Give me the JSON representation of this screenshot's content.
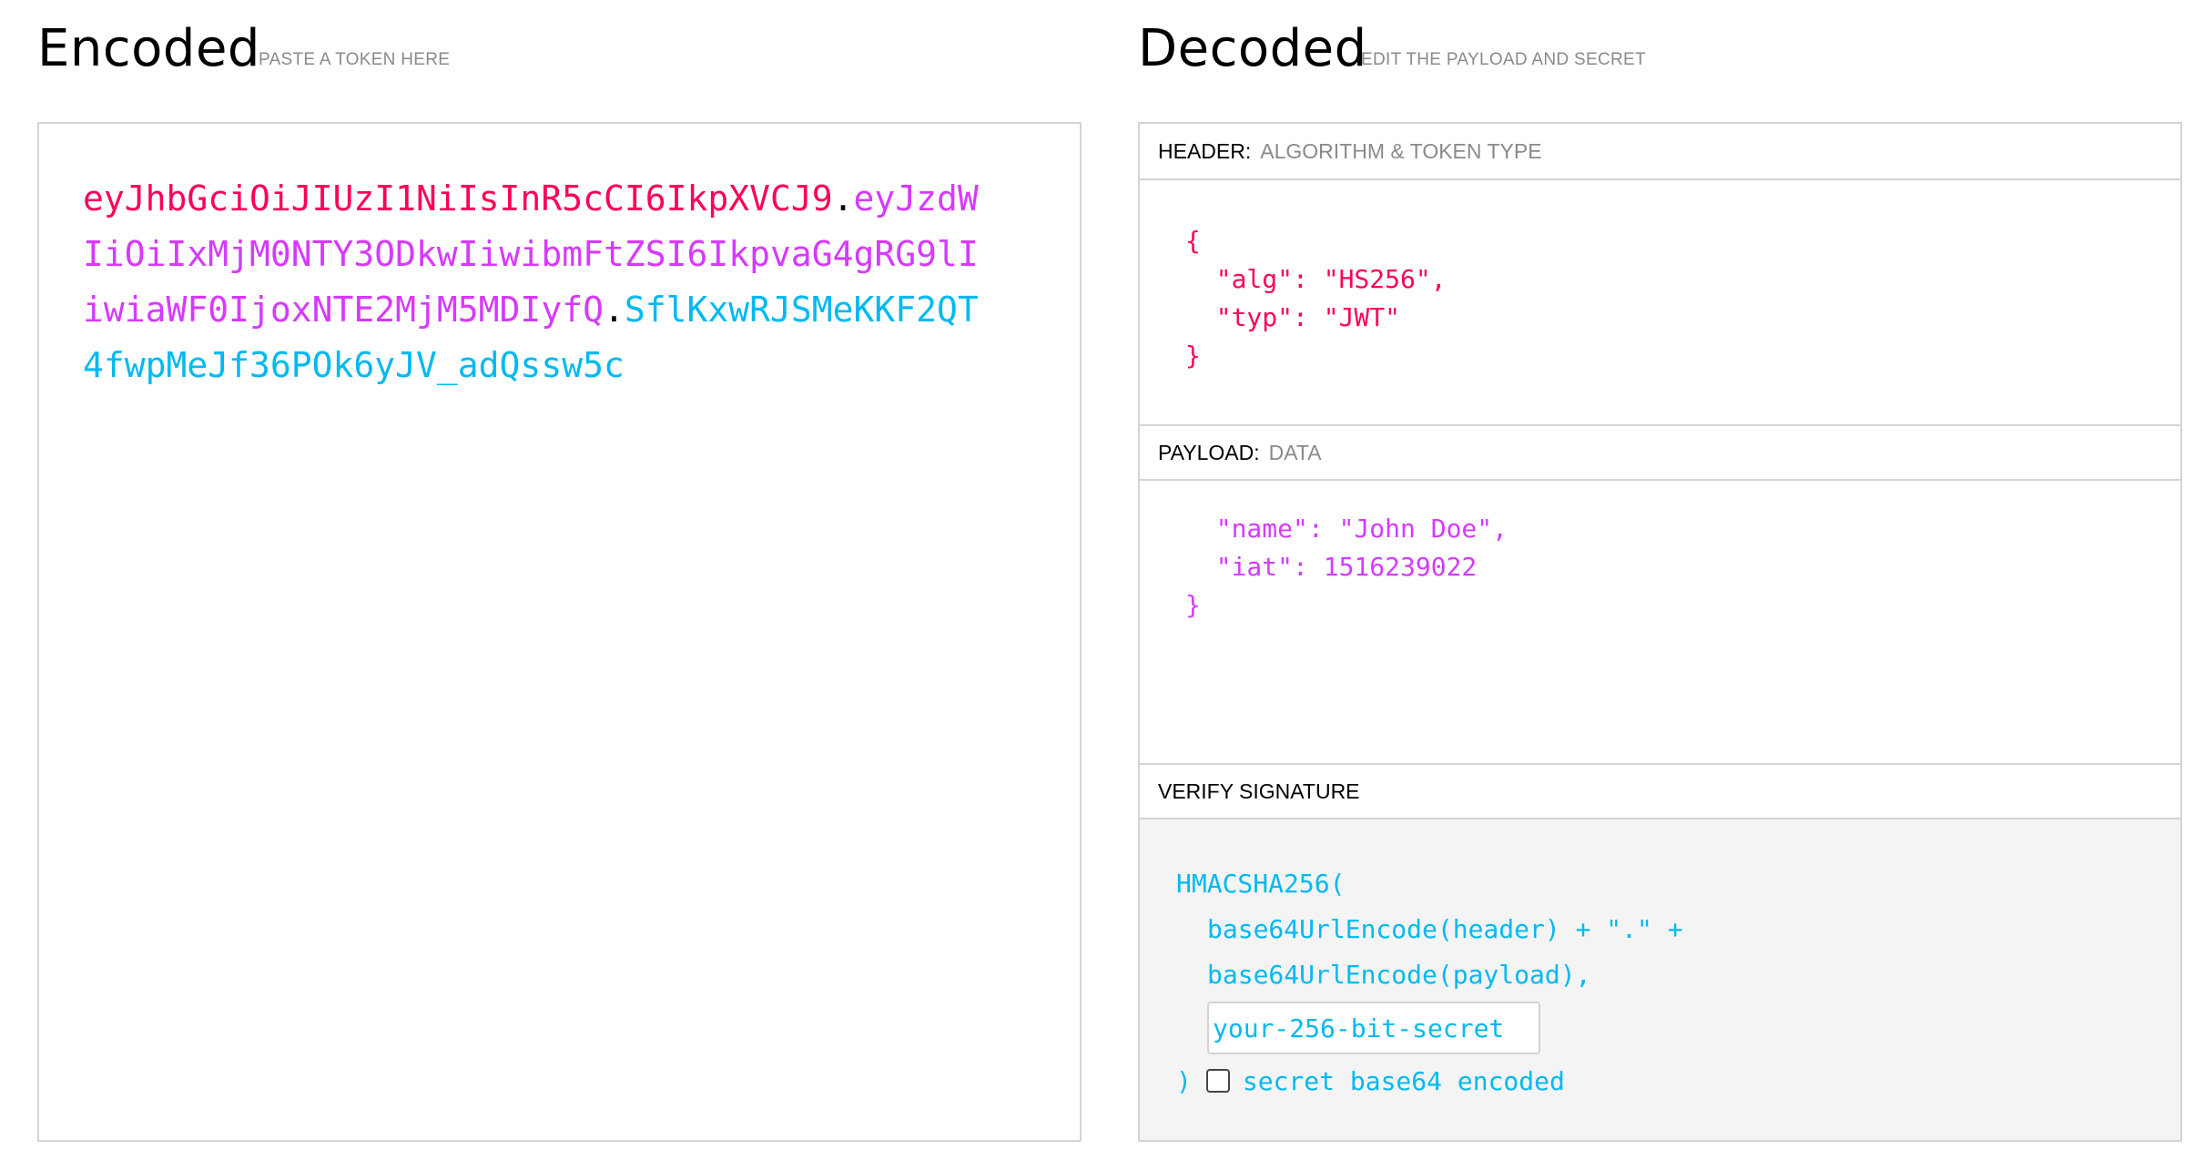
{
  "encoded": {
    "title": "Encoded",
    "subtitle": "PASTE A TOKEN HERE",
    "token_header": "eyJhbGciOiJIUzI1NiIsInR5cCI6IkpXVCJ9",
    "dot1": ".",
    "token_payload": "eyJzdWIiOiIxMjM0NTY3ODkwIiwibmFtZSI6IkpvaG4gRG9lIiwiaWF0IjoxNTE2MjM5MDIyfQ",
    "dot2": ".",
    "token_signature": "SflKxwRJSMeKKF2QT4fwpMeJf36POk6yJV_adQssw5c"
  },
  "decoded": {
    "title": "Decoded",
    "subtitle": "EDIT THE PAYLOAD AND SECRET",
    "header": {
      "label": "HEADER:",
      "sublabel": "ALGORITHM & TOKEN TYPE",
      "code": "{\n  \"alg\": \"HS256\",\n  \"typ\": \"JWT\"\n}"
    },
    "payload": {
      "label": "PAYLOAD:",
      "sublabel": "DATA",
      "code": "  \"name\": \"John Doe\",\n  \"iat\": 1516239022\n}"
    },
    "verify": {
      "label": "VERIFY SIGNATURE",
      "line1": "HMACSHA256(",
      "line2": "base64UrlEncode(header) + \".\" +",
      "line3": "base64UrlEncode(payload),",
      "secret_value": "your-256-bit-secret",
      "close_paren": ")",
      "checkbox_label": "secret base64 encoded",
      "checkbox_checked": false
    }
  },
  "colors": {
    "header": "#fb015b",
    "payload": "#d63aff",
    "signature": "#00b9f1"
  }
}
